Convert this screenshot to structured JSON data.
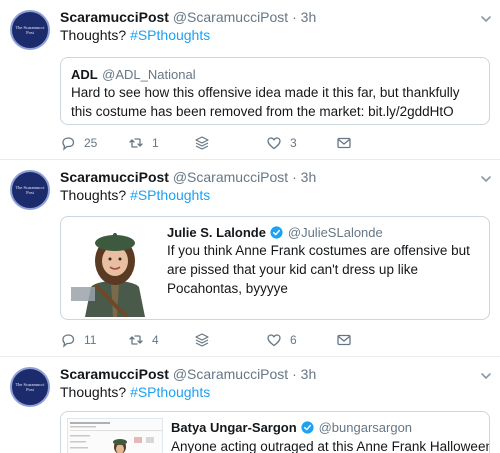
{
  "tweets": [
    {
      "author_name": "ScaramucciPost",
      "author_handle": "@ScaramucciPost",
      "dot": "·",
      "time": "3h",
      "text_prefix": "Thoughts? ",
      "hashtag": "#SPthoughts",
      "avatar_text": "The Scaramucci Post",
      "quoted": {
        "name": "ADL",
        "handle": "@ADL_National",
        "text": "Hard to see how this offensive idea made it this far, but thankfully this costume has been removed from the market: bit.ly/2gddHtO"
      },
      "actions": {
        "replies": "25",
        "retweets": "1",
        "likes": "3"
      }
    },
    {
      "author_name": "ScaramucciPost",
      "author_handle": "@ScaramucciPost",
      "dot": "·",
      "time": "3h",
      "text_prefix": "Thoughts? ",
      "hashtag": "#SPthoughts",
      "avatar_text": "The Scaramucci Post",
      "quoted": {
        "name": "Julie S. Lalonde",
        "handle": "@JulieSLalonde",
        "text": "If you think Anne Frank costumes are offensive but are pissed that your kid can't dress up like Pocahontas, byyyye",
        "verified": true
      },
      "actions": {
        "replies": "11",
        "retweets": "4",
        "likes": "6"
      }
    },
    {
      "author_name": "ScaramucciPost",
      "author_handle": "@ScaramucciPost",
      "dot": "·",
      "time": "3h",
      "text_prefix": "Thoughts? ",
      "hashtag": "#SPthoughts",
      "avatar_text": "The Scaramucci Post",
      "quoted": {
        "name": "Batya Ungar-Sargon",
        "handle": "@bungarsargon",
        "text": "Anyone acting outraged at this Anne Frank Halloween",
        "verified": true
      }
    }
  ],
  "colors": {
    "link": "#1da1f2",
    "muted": "#657786",
    "border": "#ccd6dd",
    "verified": "#1da1f2"
  },
  "icons": [
    "chevron-down-icon",
    "reply-icon",
    "retweet-icon",
    "stack-icon",
    "heart-icon",
    "mail-icon",
    "verified-icon"
  ]
}
